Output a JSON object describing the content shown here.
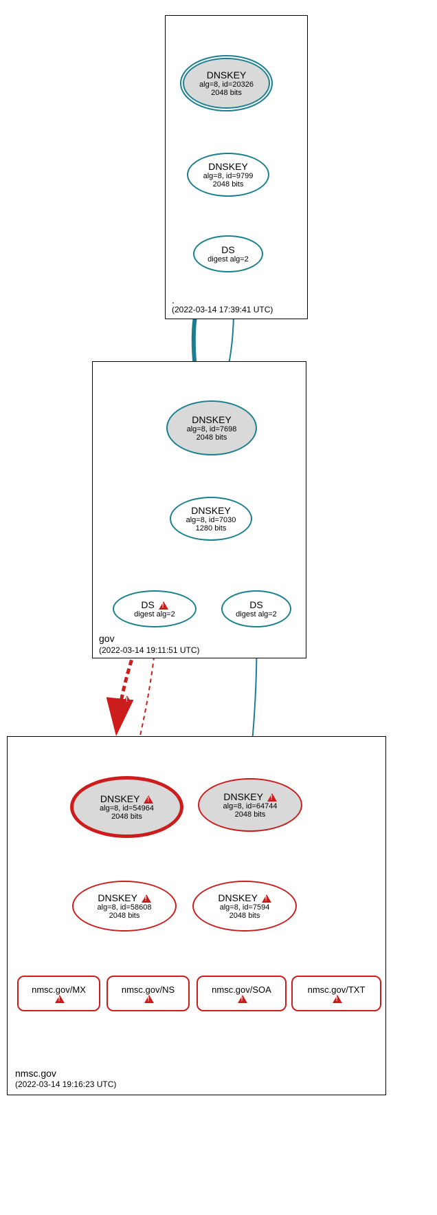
{
  "chart_data": {
    "type": "diagram",
    "description": "DNSSEC authentication chain / delegation graph",
    "zones": {
      "root": {
        "name": ".",
        "timestamp": "(2022-03-14 17:39:41 UTC)"
      },
      "gov": {
        "name": "gov",
        "timestamp": "(2022-03-14 19:11:51 UTC)"
      },
      "nmsc": {
        "name": "nmsc.gov",
        "timestamp": "(2022-03-14 19:16:23 UTC)"
      }
    },
    "nodes": {
      "root_ksk": {
        "title": "DNSKEY",
        "line1": "alg=8, id=20326",
        "line2": "2048 bits"
      },
      "root_zsk": {
        "title": "DNSKEY",
        "line1": "alg=8, id=9799",
        "line2": "2048 bits"
      },
      "root_ds": {
        "title": "DS",
        "line1": "digest alg=2"
      },
      "gov_ksk": {
        "title": "DNSKEY",
        "line1": "alg=8, id=7698",
        "line2": "2048 bits"
      },
      "gov_zsk": {
        "title": "DNSKEY",
        "line1": "alg=8, id=7030",
        "line2": "1280 bits"
      },
      "gov_ds1": {
        "title": "DS",
        "line1": "digest alg=2",
        "warn": true
      },
      "gov_ds2": {
        "title": "DS",
        "line1": "digest alg=2"
      },
      "nmsc_k54964": {
        "title": "DNSKEY",
        "line1": "alg=8, id=54964",
        "line2": "2048 bits",
        "warn": true
      },
      "nmsc_k64744": {
        "title": "DNSKEY",
        "line1": "alg=8, id=64744",
        "line2": "2048 bits",
        "warn": true
      },
      "nmsc_k58608": {
        "title": "DNSKEY",
        "line1": "alg=8, id=58608",
        "line2": "2048 bits",
        "warn": true
      },
      "nmsc_k7594": {
        "title": "DNSKEY",
        "line1": "alg=8, id=7594",
        "line2": "2048 bits",
        "warn": true
      }
    },
    "rrsets": {
      "mx": "nmsc.gov/MX",
      "ns": "nmsc.gov/NS",
      "soa": "nmsc.gov/SOA",
      "txt": "nmsc.gov/TXT"
    }
  }
}
